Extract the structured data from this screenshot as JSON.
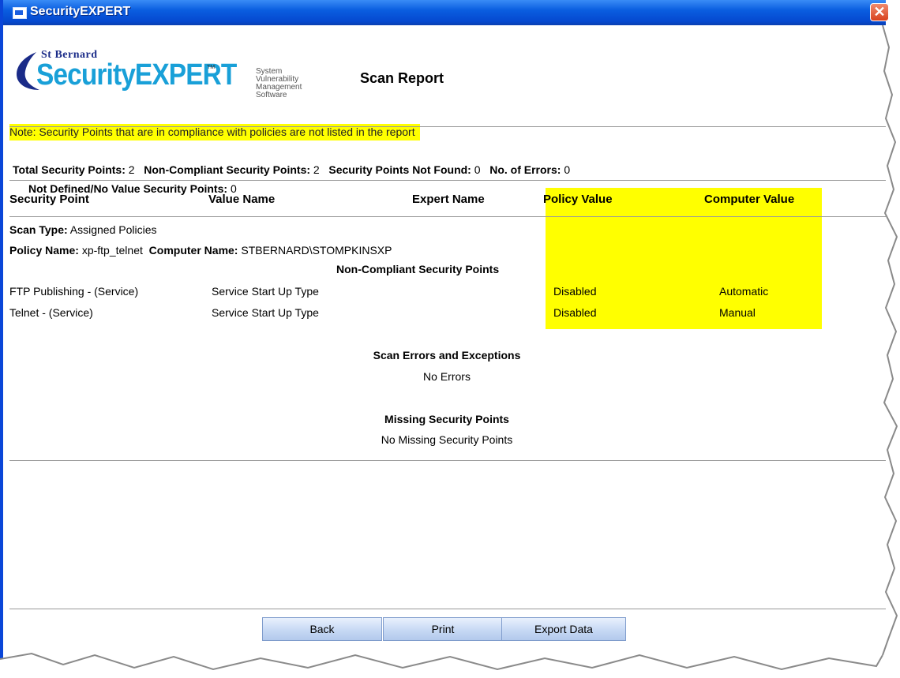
{
  "window": {
    "title": "SecurityEXPERT"
  },
  "logo": {
    "company": "St Bernard",
    "product": "SecurityEXPERT",
    "trademark": "TM",
    "tagline": [
      "System",
      "Vulnerability",
      "Management",
      "Software"
    ]
  },
  "report": {
    "title": "Scan Report",
    "note": "Note: Security Points that are in compliance with policies are not listed in the report"
  },
  "summary": {
    "total_label": "Total Security Points:",
    "total_value": "2",
    "noncompliant_label": "Non-Compliant Security Points:",
    "noncompliant_value": "2",
    "notfound_label": "Security Points Not Found:",
    "notfound_value": "0",
    "errors_label": "No. of Errors:",
    "errors_value": "0",
    "notdefined_label": "Not Defined/No Value Security Points:",
    "notdefined_value": "0"
  },
  "table": {
    "headers": {
      "security_point": "Security Point",
      "value_name": "Value Name",
      "expert_name": "Expert Name",
      "policy_value": "Policy Value",
      "computer_value": "Computer Value"
    },
    "scan_type_label": "Scan Type:",
    "scan_type": "Assigned Policies",
    "policy_name_label": "Policy Name:",
    "policy_name": "xp-ftp_telnet",
    "computer_name_label": "Computer Name:",
    "computer_name": "STBERNARD\\STOMPKINSXP",
    "noncompliant_heading": "Non-Compliant Security Points",
    "rows": [
      {
        "security_point": "FTP Publishing - (Service)",
        "value_name": "Service Start Up Type",
        "expert_name": "",
        "policy_value": "Disabled",
        "computer_value": "Automatic"
      },
      {
        "security_point": "Telnet - (Service)",
        "value_name": "Service Start Up Type",
        "expert_name": "",
        "policy_value": "Disabled",
        "computer_value": "Manual"
      }
    ]
  },
  "errors": {
    "heading": "Scan Errors and Exceptions",
    "text": "No Errors"
  },
  "missing": {
    "heading": "Missing Security Points",
    "text": "No Missing Security Points"
  },
  "buttons": {
    "back": "Back",
    "print": "Print",
    "export": "Export Data"
  },
  "colors": {
    "highlight": "#ffff00",
    "titlebar": "#0a5ee0",
    "brand": "#19a0d8"
  }
}
